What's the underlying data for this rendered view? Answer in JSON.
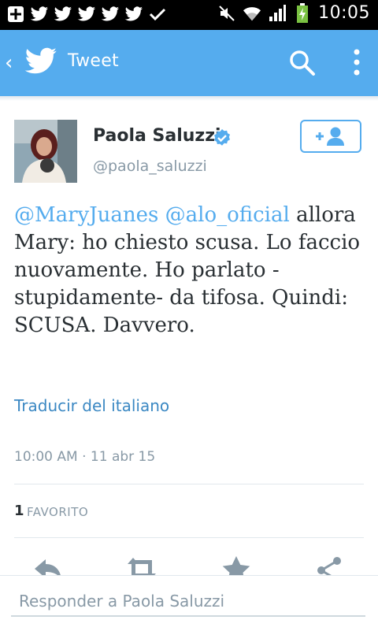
{
  "status_bar": {
    "time": "10:05",
    "left_icons": [
      "add-box-icon",
      "twitter-bird-icon",
      "twitter-bird-icon",
      "twitter-bird-icon",
      "twitter-bird-icon",
      "twitter-bird-icon",
      "check-icon"
    ],
    "right_icons": [
      "mute-icon",
      "wifi-icon",
      "signal-icon",
      "battery-charging-icon"
    ]
  },
  "app_bar": {
    "title": "Tweet",
    "color": "#55acee"
  },
  "tweet": {
    "author_name": "Paola Saluzzi",
    "handle": "@paola_saluzzi",
    "verified": true,
    "mention_1": "@MaryJuanes",
    "mention_2": "@alo_oficial",
    "body": "allora Mary: ho chiesto scusa. Lo faccio nuovamente. Ho parlato -stupidamente- da tifosa. Quindi: SCUSA. Davvero.",
    "translate_link": "Traducir del italiano",
    "timestamp": "10:00 AM · 11 abr 15",
    "favorites_count": "1",
    "favorites_label": "FAVORITO"
  },
  "reply": {
    "placeholder": "Responder a Paola Saluzzi"
  }
}
